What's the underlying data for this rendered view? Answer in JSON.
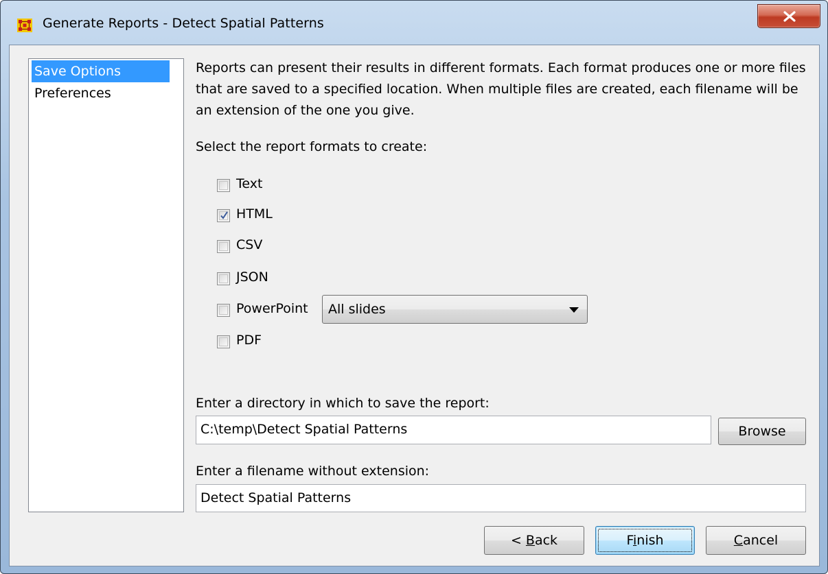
{
  "window": {
    "title": "Generate Reports - Detect Spatial Patterns",
    "accent_close": "#c74f37"
  },
  "sidebar": {
    "items": [
      {
        "label": "Save Options",
        "selected": true
      },
      {
        "label": "Preferences",
        "selected": false
      }
    ]
  },
  "main": {
    "description": "Reports can present their results in different formats. Each format produces one or more files that are saved to a specified location. When multiple files are created, each filename will be an extension of the one you give.",
    "formats_label": "Select the report formats to create:",
    "formats": [
      {
        "label": "Text",
        "checked": false
      },
      {
        "label": "HTML",
        "checked": true
      },
      {
        "label": "CSV",
        "checked": false
      },
      {
        "label": "JSON",
        "checked": false
      },
      {
        "label": "PowerPoint",
        "checked": false
      },
      {
        "label": "PDF",
        "checked": false
      }
    ],
    "powerpoint_select": {
      "selected": "All slides"
    },
    "directory_label": "Enter a directory in which to save the report:",
    "directory_value": "C:\\temp\\Detect Spatial Patterns",
    "browse_label": "Browse",
    "filename_label": "Enter a filename without extension:",
    "filename_value": "Detect Spatial Patterns"
  },
  "footer": {
    "back": {
      "prefix": "< ",
      "mnemonic": "B",
      "rest": "ack"
    },
    "finish": {
      "prefix": "F",
      "mnemonic": "i",
      "rest": "nish"
    },
    "cancel": {
      "prefix": "",
      "mnemonic": "C",
      "rest": "ancel"
    }
  }
}
